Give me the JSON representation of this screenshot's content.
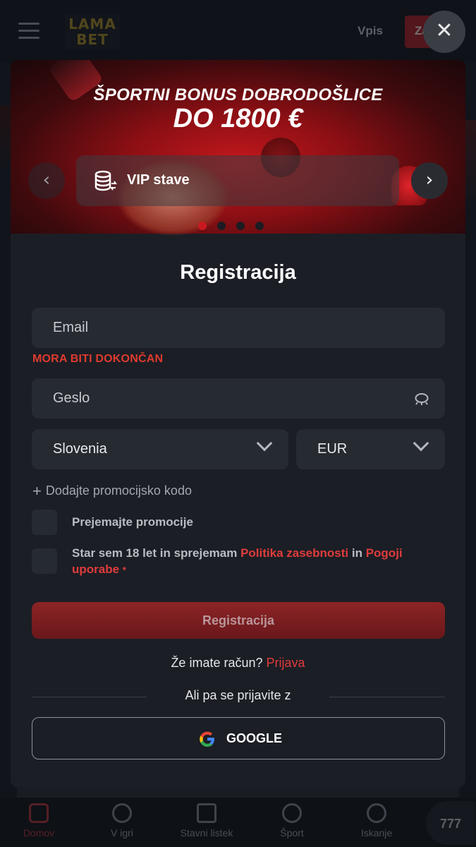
{
  "header": {
    "logo_text": "LAMA BET",
    "login_label": "Vpis",
    "signup_label_partial": "Za"
  },
  "banner": {
    "title": "ŠPORTNI BONUS DOBRODOŠLICE",
    "amount": "DO 1800 €",
    "slide_label": "VIP stave",
    "slide_count": 4,
    "active_slide": 1
  },
  "form": {
    "title": "Registracija",
    "email_placeholder": "Email",
    "email_error": "MORA BITI DOKONČAN",
    "password_placeholder": "Geslo",
    "country_value": "Slovenia",
    "currency_value": "EUR",
    "promo_label": "Dodajte promocijsko kodo",
    "promo_plus": "+",
    "receive_promotions": "Prejemajte promocije",
    "terms_prefix": "Star sem 18 let in sprejemam",
    "privacy_link": "Politika zasebnosti",
    "terms_conjunction": "in",
    "terms_link": "Pogoji uporabe",
    "required_mark": "*",
    "submit_label": "Registracija",
    "have_account": "Že imate račun?",
    "login_link": "Prijava",
    "or_text": "Ali pa se prijavite z",
    "google_label": "GOOGLE"
  },
  "close_symbol": "✕",
  "bottom_nav": {
    "items": [
      {
        "label": "Domov",
        "icon": "home-llama-icon",
        "active": true
      },
      {
        "label": "V igri",
        "icon": "live-icon"
      },
      {
        "label": "Stavni listek",
        "icon": "betslip-book-icon"
      },
      {
        "label": "Šport",
        "icon": "sports-ball-icon"
      },
      {
        "label": "Iskanje",
        "icon": "search-icon"
      }
    ],
    "slots_label": "777"
  },
  "colors": {
    "accent": "#e03c3c",
    "error": "#df3b2e",
    "modal_bg": "#1b1e25",
    "field_bg": "#262a31",
    "submit_bg": "#7a1d21"
  }
}
